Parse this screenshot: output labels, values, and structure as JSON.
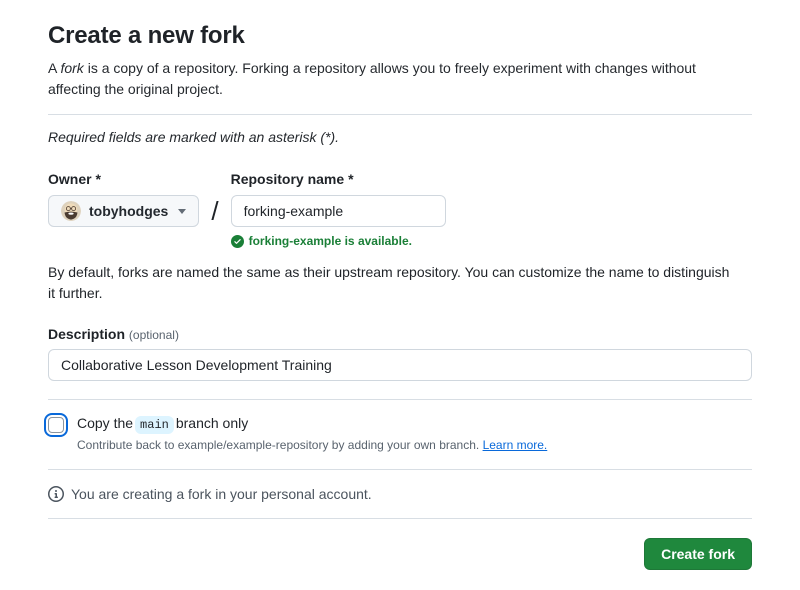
{
  "page": {
    "title": "Create a new fork",
    "intro_prefix": "A ",
    "intro_italic": "fork",
    "intro_suffix": " is a copy of a repository. Forking a repository allows you to freely experiment with changes without affecting the original project.",
    "required_note": "Required fields are marked with an asterisk (*)."
  },
  "form": {
    "owner": {
      "label": "Owner",
      "asterisk": "*",
      "selected": "tobyhodges"
    },
    "separator": "/",
    "repo": {
      "label": "Repository name",
      "asterisk": "*",
      "value": "forking-example",
      "availability": "forking-example is available."
    },
    "naming_note": "By default, forks are named the same as their upstream repository. You can customize the name to distinguish it further.",
    "description": {
      "label": "Description",
      "optional": "(optional)",
      "value": "Collaborative Lesson Development Training"
    },
    "branch": {
      "copy_prefix": "Copy the",
      "branch_name": "main",
      "copy_suffix": "branch only",
      "checked": false,
      "help_text": "Contribute back to example/example-repository by adding your own branch. ",
      "learn_more": "Learn more."
    },
    "info_note": "You are creating a fork in your personal account.",
    "submit_label": "Create fork"
  },
  "colors": {
    "success_green": "#1a7f37",
    "button_green": "#1f883d",
    "link_blue": "#0969da",
    "focus_ring_blue": "#0969da",
    "branch_token_bg": "#ddf4ff",
    "input_border": "#d0d7de",
    "divider": "#d8dee4",
    "muted_text": "#59636e",
    "body_text": "#1f2328"
  },
  "icons": {
    "check_circle": "check-circle-icon",
    "info": "info-icon",
    "chevron": "chevron-down-icon"
  }
}
